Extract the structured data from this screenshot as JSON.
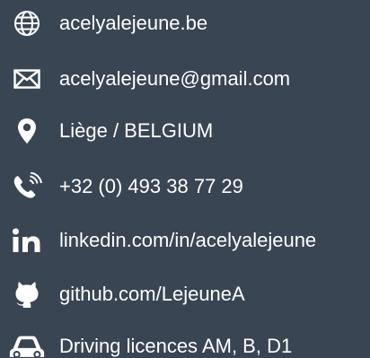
{
  "contacts": [
    {
      "icon": "globe-icon",
      "text": "acelyalejeune.be"
    },
    {
      "icon": "envelope-icon",
      "text": "acelyalejeune@gmail.com"
    },
    {
      "icon": "map-pin-icon",
      "text": "Liège / BELGIUM"
    },
    {
      "icon": "phone-icon",
      "text": "+32 (0) 493 38 77 29"
    },
    {
      "icon": "linkedin-icon",
      "text": "linkedin.com/in/acelyalejeune"
    },
    {
      "icon": "github-icon",
      "text": "github.com/LejeuneA"
    },
    {
      "icon": "car-icon",
      "text": "Driving licences AM, B, D1"
    }
  ],
  "colors": {
    "background": "#3a4553",
    "text": "#ffffff"
  }
}
